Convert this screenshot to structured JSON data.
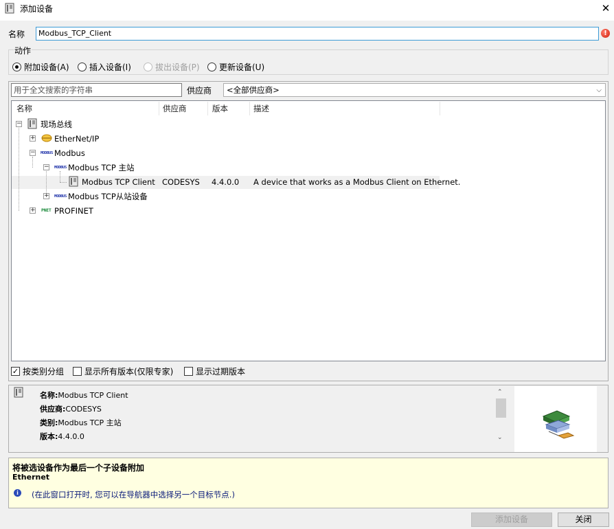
{
  "window": {
    "title": "添加设备",
    "close_glyph": "✕"
  },
  "name_field": {
    "label": "名称",
    "value": "Modbus_TCP_Client",
    "error_glyph": "!"
  },
  "action": {
    "legend": "动作",
    "options": [
      {
        "label": "附加设备(A)",
        "selected": true
      },
      {
        "label": "插入设备(I)",
        "selected": false
      },
      {
        "label": "拔出设备(P)",
        "selected": false,
        "disabled": true
      },
      {
        "label": "更新设备(U)",
        "selected": false
      }
    ]
  },
  "search": {
    "placeholder": "用于全文搜索的字符串",
    "vendor_label": "供应商",
    "vendor_value": "<全部供应商>",
    "chevron": "⌵"
  },
  "tree": {
    "columns": [
      "名称",
      "供应商",
      "版本",
      "描述"
    ],
    "icon_labels": {
      "modbus": "MODBUS",
      "profinet": "PNET"
    },
    "nodes": [
      {
        "label": "现场总线",
        "icon": "device-icon",
        "expander": "−"
      },
      {
        "label": "EtherNet/IP",
        "icon": "ethernet-ip-icon",
        "expander": "+"
      },
      {
        "label": "Modbus",
        "icon": "modbus-icon",
        "expander": "−"
      },
      {
        "label": "Modbus TCP 主站",
        "icon": "modbus-icon",
        "expander": "−"
      },
      {
        "label": "Modbus TCP Client",
        "icon": "device-icon",
        "vendor": "CODESYS",
        "version": "4.4.0.0",
        "description": "A device that works as a Modbus Client on Ethernet."
      },
      {
        "label": "Modbus TCP从站设备",
        "icon": "modbus-icon",
        "expander": "+"
      },
      {
        "label": "PROFINET",
        "icon": "profinet-icon",
        "expander": "+"
      }
    ]
  },
  "options": {
    "group_by_category": {
      "label": "按类别分组",
      "checked": true,
      "check_glyph": "✓"
    },
    "show_all_versions": {
      "label": "显示所有版本(仅限专家)",
      "checked": false
    },
    "show_outdated": {
      "label": "显示过期版本",
      "checked": false
    }
  },
  "info": {
    "name_key": "名称:",
    "name_val": "Modbus TCP Client",
    "vendor_key": "供应商:",
    "vendor_val": "CODESYS",
    "category_key": "类别:",
    "category_val": "Modbus TCP 主站",
    "version_key": "版本:",
    "version_val": "4.4.0.0",
    "scroll_up": "⌃",
    "scroll_down": "⌄"
  },
  "hint": {
    "title": "将被选设备作为最后一个子设备附加",
    "subtitle": "Ethernet",
    "info_glyph": "i",
    "text": "(在此窗口打开时, 您可以在导航器中选择另一个目标节点.)"
  },
  "buttons": {
    "add": "添加设备",
    "close": "关闭"
  },
  "colors": {
    "accent_border": "#3c9bd6",
    "hint_bg": "#ffffe1",
    "hint_text": "#0a1a7a",
    "modbus_blue": "#1b2fa8",
    "error_red": "#d0200c"
  }
}
